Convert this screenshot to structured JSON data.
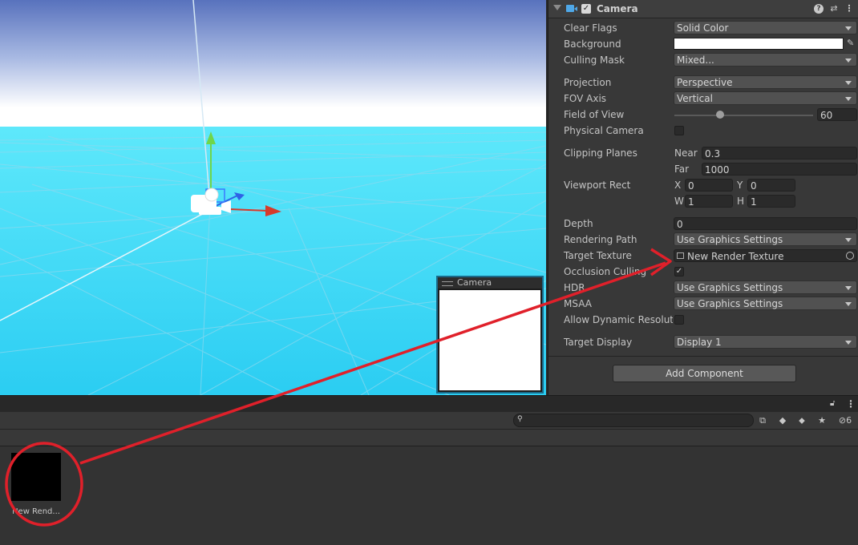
{
  "inspector": {
    "component_title": "Camera",
    "component_enabled": true,
    "header_icons": [
      "help-icon",
      "preset-icon",
      "kebab-menu-icon"
    ],
    "properties": {
      "clear_flags": {
        "label": "Clear Flags",
        "value": "Solid Color"
      },
      "background": {
        "label": "Background",
        "color": "#ffffff"
      },
      "culling_mask": {
        "label": "Culling Mask",
        "value": "Mixed..."
      },
      "projection": {
        "label": "Projection",
        "value": "Perspective"
      },
      "fov_axis": {
        "label": "FOV Axis",
        "value": "Vertical"
      },
      "field_of_view": {
        "label": "Field of View",
        "value": "60",
        "slider_fraction": 0.33
      },
      "physical_camera": {
        "label": "Physical Camera",
        "checked": false
      },
      "clipping_planes": {
        "label": "Clipping Planes",
        "near_label": "Near",
        "near": "0.3",
        "far_label": "Far",
        "far": "1000"
      },
      "viewport_rect": {
        "label": "Viewport Rect",
        "x_label": "X",
        "x": "0",
        "y_label": "Y",
        "y": "0",
        "w_label": "W",
        "w": "1",
        "h_label": "H",
        "h": "1"
      },
      "depth": {
        "label": "Depth",
        "value": "0"
      },
      "rendering_path": {
        "label": "Rendering Path",
        "value": "Use Graphics Settings"
      },
      "target_texture": {
        "label": "Target Texture",
        "value": "New Render Texture"
      },
      "occlusion_culling": {
        "label": "Occlusion Culling",
        "checked": true
      },
      "hdr": {
        "label": "HDR",
        "value": "Use Graphics Settings"
      },
      "msaa": {
        "label": "MSAA",
        "value": "Use Graphics Settings"
      },
      "allow_dynamic_resolution": {
        "label": "Allow Dynamic Resolution",
        "checked": false
      },
      "target_display": {
        "label": "Target Display",
        "value": "Display 1"
      }
    },
    "add_component_label": "Add Component"
  },
  "scene": {
    "camera_preview_title": "Camera",
    "sky_color": "#5a78c0",
    "ground_color": "#33d6f5"
  },
  "project": {
    "search_placeholder": "",
    "hidden_count": "6",
    "assets": [
      {
        "name": "New Rend..."
      }
    ]
  },
  "annotation": {
    "color": "#e0202a"
  }
}
